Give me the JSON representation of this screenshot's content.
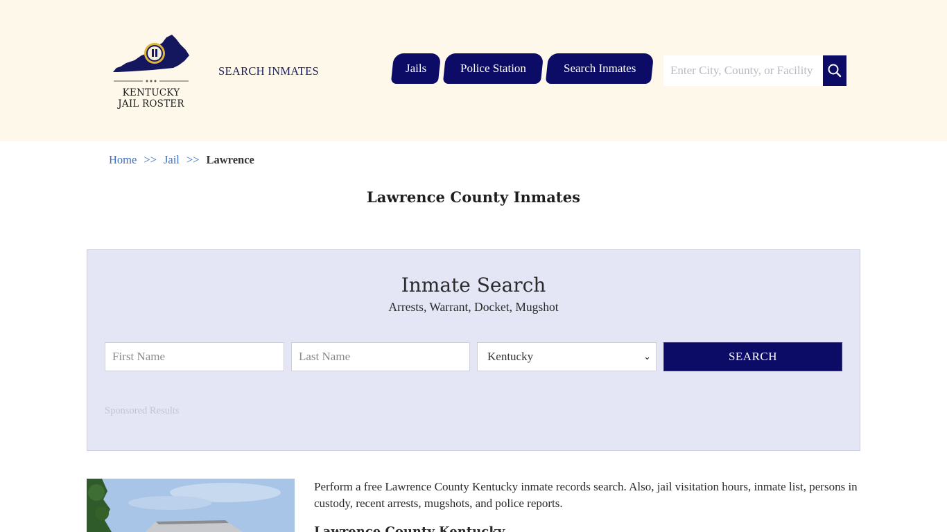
{
  "header": {
    "logo": {
      "line1": "KENTUCKY",
      "line2": "JAIL ROSTER"
    },
    "brand_link": "SEARCH INMATES",
    "nav": [
      {
        "label": "Jails"
      },
      {
        "label": "Police Station"
      },
      {
        "label": "Search Inmates"
      }
    ],
    "search": {
      "placeholder": "Enter City, County, or Facility",
      "icon": "search-icon"
    }
  },
  "breadcrumb": {
    "home": "Home",
    "sep1": ">>",
    "jail": "Jail",
    "sep2": ">>",
    "current": "Lawrence"
  },
  "page_title": "Lawrence County Inmates",
  "inmate_search": {
    "title": "Inmate Search",
    "subtitle": "Arrests, Warrant, Docket, Mugshot",
    "first_name_placeholder": "First Name",
    "last_name_placeholder": "Last Name",
    "state_selected": "Kentucky",
    "submit_label": "SEARCH",
    "sponsored": "Sponsored Results"
  },
  "content": {
    "intro": "Perform a free Lawrence County Kentucky inmate records search. Also, jail visitation hours, inmate list, persons in custody, recent arrests, mugshots, and police reports.",
    "sub_heading": "Lawrence County Kentucky"
  },
  "colors": {
    "header_bg": "#fef8ea",
    "nav_bg": "#0c0c66",
    "panel_bg": "#e4e6f6",
    "link": "#3d6fc6"
  }
}
